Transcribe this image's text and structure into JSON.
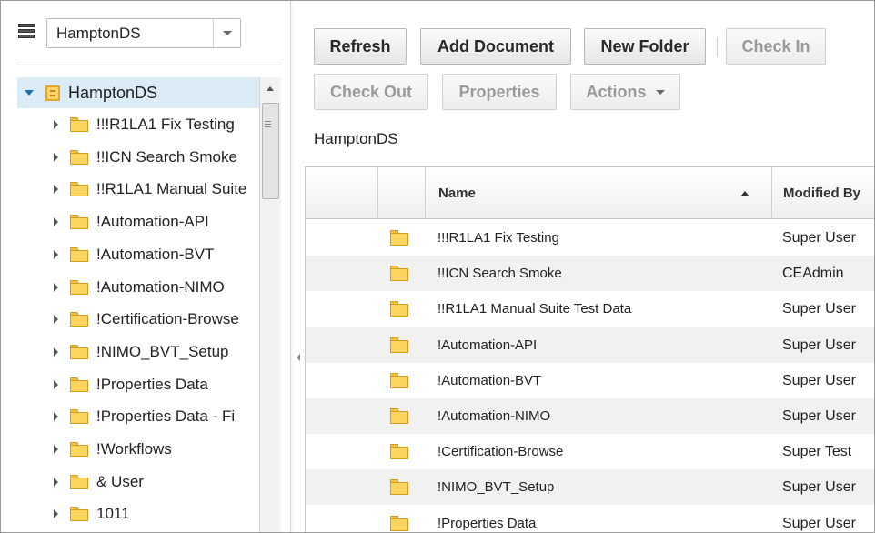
{
  "repository": {
    "selected": "HamptonDS",
    "icon": "repository-icon"
  },
  "tree": {
    "root": {
      "label": "HamptonDS",
      "icon": "repository-folder-icon"
    },
    "items": [
      {
        "label": "!!!R1LA1 Fix Testing"
      },
      {
        "label": "!!ICN Search Smoke"
      },
      {
        "label": "!!R1LA1 Manual Suite"
      },
      {
        "label": "!Automation-API"
      },
      {
        "label": "!Automation-BVT"
      },
      {
        "label": "!Automation-NIMO"
      },
      {
        "label": "!Certification-Browse"
      },
      {
        "label": "!NIMO_BVT_Setup"
      },
      {
        "label": "!Properties Data"
      },
      {
        "label": "!Properties Data - Fi"
      },
      {
        "label": "!Workflows"
      },
      {
        "label": "& User"
      },
      {
        "label": "1011"
      }
    ]
  },
  "toolbar": {
    "refresh": "Refresh",
    "add_document": "Add Document",
    "new_folder": "New Folder",
    "check_in": "Check In",
    "check_out": "Check Out",
    "properties": "Properties",
    "actions": "Actions"
  },
  "breadcrumb": "HamptonDS",
  "grid": {
    "columns": {
      "name": "Name",
      "modified_by": "Modified By"
    },
    "sort": "ascending",
    "rows": [
      {
        "name": "!!!R1LA1 Fix Testing",
        "modified_by": "Super User"
      },
      {
        "name": "!!ICN Search Smoke",
        "modified_by": "CEAdmin"
      },
      {
        "name": "!!R1LA1 Manual Suite Test Data",
        "modified_by": "Super User"
      },
      {
        "name": "!Automation-API",
        "modified_by": "Super User"
      },
      {
        "name": "!Automation-BVT",
        "modified_by": "Super User"
      },
      {
        "name": "!Automation-NIMO",
        "modified_by": "Super User"
      },
      {
        "name": "!Certification-Browse",
        "modified_by": "Super Test"
      },
      {
        "name": "!NIMO_BVT_Setup",
        "modified_by": "Super User"
      },
      {
        "name": "!Properties Data",
        "modified_by": "Super User"
      }
    ]
  },
  "colors": {
    "selection": "#dcecf6",
    "folder": "#fbd560",
    "alt_row": "#f1f1f1"
  }
}
